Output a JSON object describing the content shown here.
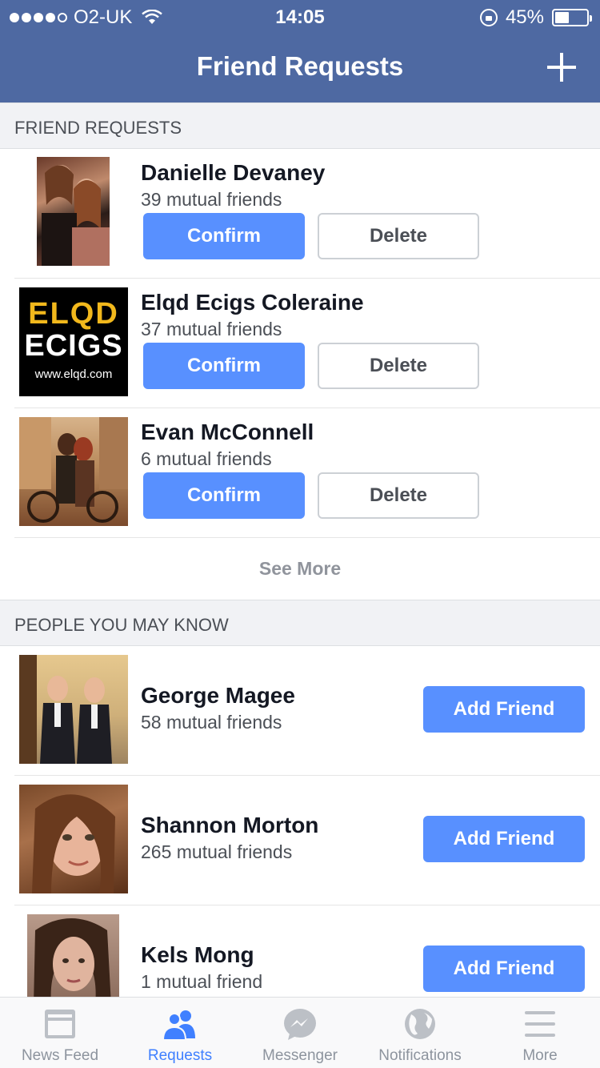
{
  "status_bar": {
    "carrier": "O2-UK",
    "time": "14:05",
    "battery_text": "45%",
    "battery_level": 0.45
  },
  "header": {
    "title": "Friend Requests"
  },
  "friend_requests": {
    "section_title": "FRIEND REQUESTS",
    "confirm_label": "Confirm",
    "delete_label": "Delete",
    "items": [
      {
        "name": "Danielle Devaney",
        "mutual": "39 mutual friends"
      },
      {
        "name": "Elqd Ecigs Coleraine",
        "mutual": "37 mutual friends",
        "logo_line1": "ELQD",
        "logo_line2": "ECIGS",
        "logo_url": "www.elqd.com"
      },
      {
        "name": "Evan McConnell",
        "mutual": "6 mutual friends"
      }
    ],
    "see_more": "See More"
  },
  "people_you_may_know": {
    "section_title": "PEOPLE YOU MAY KNOW",
    "add_label": "Add Friend",
    "items": [
      {
        "name": "George Magee",
        "mutual": "58 mutual friends"
      },
      {
        "name": "Shannon Morton",
        "mutual": "265 mutual friends"
      },
      {
        "name": "Kels Mong",
        "mutual": "1 mutual friend"
      }
    ]
  },
  "tabbar": {
    "items": [
      {
        "label": "News Feed",
        "icon": "news-feed-icon"
      },
      {
        "label": "Requests",
        "icon": "requests-icon",
        "active": true
      },
      {
        "label": "Messenger",
        "icon": "messenger-icon"
      },
      {
        "label": "Notifications",
        "icon": "globe-icon"
      },
      {
        "label": "More",
        "icon": "menu-icon"
      }
    ]
  },
  "colors": {
    "header": "#4e69a2",
    "accent": "#5890ff",
    "active_tab": "#4080ff",
    "section_bg": "#f1f2f5"
  }
}
